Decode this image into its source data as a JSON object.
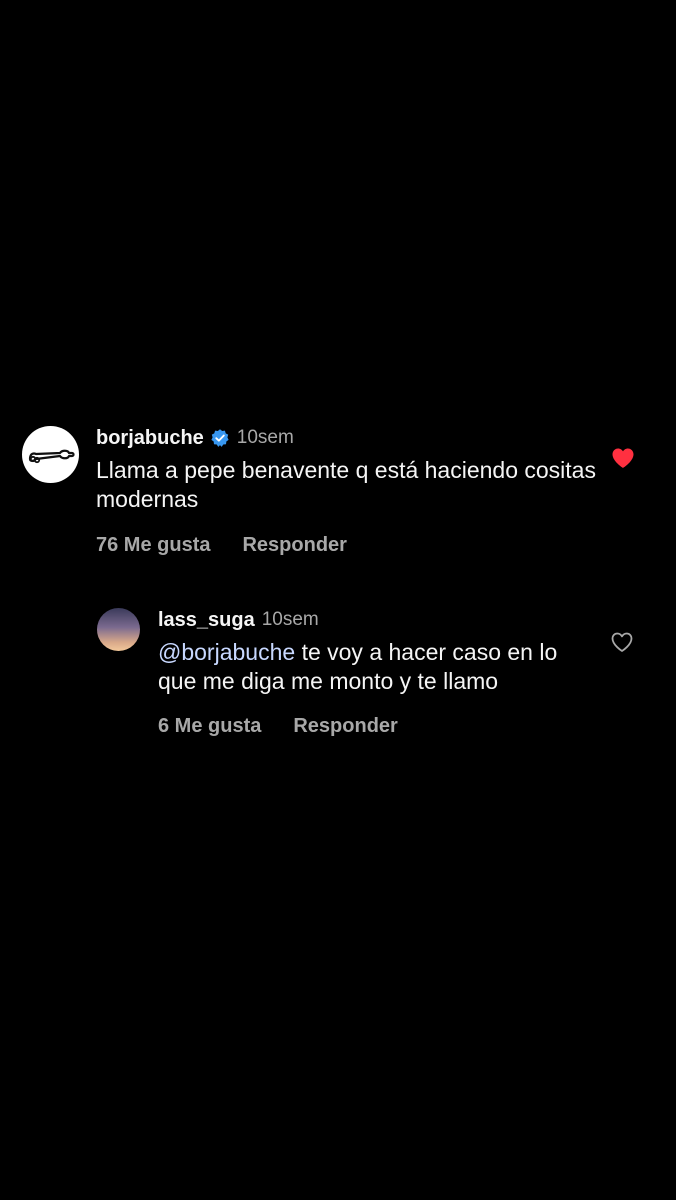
{
  "comments": [
    {
      "username": "borjabuche",
      "verified": true,
      "time": "10sem",
      "text": "Llama a pepe benavente q está haciendo cositas modernas",
      "likes_label": "76 Me gusta",
      "reply_label": "Responder",
      "liked": true
    },
    {
      "username": "lass_suga",
      "verified": false,
      "time": "10sem",
      "mention": "@borjabuche",
      "text": "te voy a hacer caso en lo que me diga me monto y te llamo",
      "likes_label": "6 Me gusta",
      "reply_label": "Responder",
      "liked": false
    }
  ],
  "colors": {
    "background": "#000000",
    "text": "#f5f5f5",
    "secondary": "#a8a8a8",
    "verified": "#3897f0",
    "like": "#ff3040",
    "mention": "#c8d8ff"
  },
  "icons": {
    "verified": "verified-badge-icon",
    "liked": "heart-filled-icon",
    "unliked": "heart-outline-icon"
  }
}
